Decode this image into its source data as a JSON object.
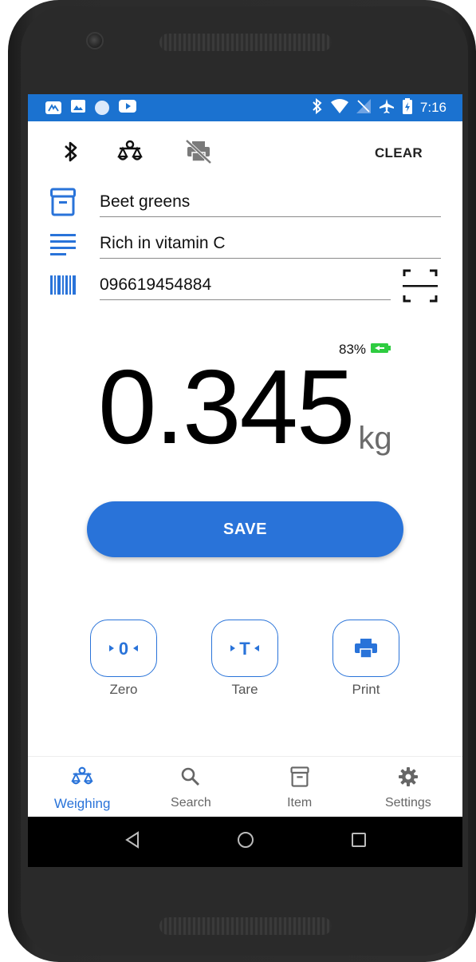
{
  "status_bar": {
    "time": "7:16",
    "left_icons": [
      "app-icon",
      "image-icon",
      "circle-icon",
      "youtube-icon"
    ],
    "right_icons": [
      "bluetooth-icon",
      "wifi-icon",
      "no-sim-icon",
      "airplane-icon",
      "battery-charging-icon"
    ]
  },
  "toolbar": {
    "clear_label": "CLEAR",
    "icons": [
      "bluetooth-icon",
      "scale-icon",
      "printer-off-icon"
    ]
  },
  "form": {
    "item_name": "Beet greens",
    "description": "Rich in vitamin C",
    "barcode": "096619454884"
  },
  "scale": {
    "battery_percent": "83%",
    "weight": "0.345",
    "unit": "kg"
  },
  "save_label": "SAVE",
  "actions": [
    {
      "label": "Zero",
      "glyph": "0"
    },
    {
      "label": "Tare",
      "glyph": "T"
    },
    {
      "label": "Print",
      "glyph": ""
    }
  ],
  "bottom_nav": [
    {
      "label": "Weighing",
      "icon": "scale-icon",
      "active": true
    },
    {
      "label": "Search",
      "icon": "search-icon",
      "active": false
    },
    {
      "label": "Item",
      "icon": "archive-icon",
      "active": false
    },
    {
      "label": "Settings",
      "icon": "gear-icon",
      "active": false
    }
  ],
  "colors": {
    "accent": "#2973d9",
    "status_bar": "#1b72d0",
    "battery_green": "#2ecc40"
  }
}
